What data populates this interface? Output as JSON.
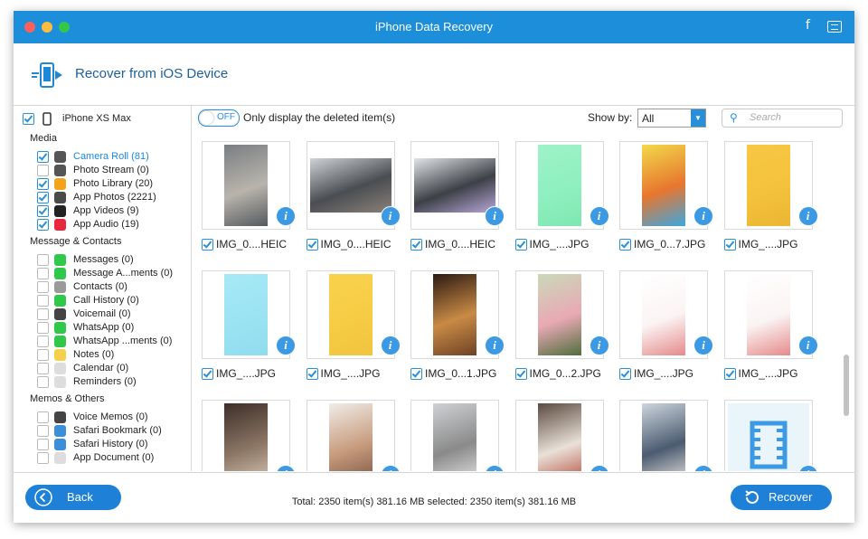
{
  "window": {
    "title": "iPhone Data Recovery"
  },
  "header": {
    "title": "Recover from iOS Device",
    "icon": "phone-transfer-icon"
  },
  "sidebar": {
    "device": {
      "label": "iPhone XS Max",
      "checked": true
    },
    "sections": [
      {
        "title": "Media",
        "items": [
          {
            "label": "Camera Roll (81)",
            "checked": true,
            "active": true,
            "icon": "camera-icon",
            "color": "#555555"
          },
          {
            "label": "Photo Stream (0)",
            "checked": false,
            "active": false,
            "icon": "photo-stream-icon",
            "color": "#555555"
          },
          {
            "label": "Photo Library (20)",
            "checked": true,
            "active": false,
            "icon": "photos-icon",
            "color": "#f3a21b"
          },
          {
            "label": "App Photos (2221)",
            "checked": true,
            "active": false,
            "icon": "app-photos-icon",
            "color": "#4a4a4a"
          },
          {
            "label": "App Videos (9)",
            "checked": true,
            "active": false,
            "icon": "app-videos-icon",
            "color": "#222222"
          },
          {
            "label": "App Audio (19)",
            "checked": true,
            "active": false,
            "icon": "music-icon",
            "color": "#e8283d"
          }
        ]
      },
      {
        "title": "Message & Contacts",
        "items": [
          {
            "label": "Messages (0)",
            "checked": false,
            "icon": "messages-icon",
            "color": "#2fc84a"
          },
          {
            "label": "Message A...ments (0)",
            "checked": false,
            "icon": "attachment-icon",
            "color": "#2fc84a"
          },
          {
            "label": "Contacts (0)",
            "checked": false,
            "icon": "contacts-icon",
            "color": "#9a9a9a"
          },
          {
            "label": "Call History (0)",
            "checked": false,
            "icon": "phone-icon",
            "color": "#2fc84a"
          },
          {
            "label": "Voicemail (0)",
            "checked": false,
            "icon": "voicemail-icon",
            "color": "#444444"
          },
          {
            "label": "WhatsApp (0)",
            "checked": false,
            "icon": "whatsapp-icon",
            "color": "#2fc84a"
          },
          {
            "label": "WhatsApp ...ments (0)",
            "checked": false,
            "icon": "whatsapp-attachment-icon",
            "color": "#2fc84a"
          },
          {
            "label": "Notes (0)",
            "checked": false,
            "icon": "notes-icon",
            "color": "#f5d04a"
          },
          {
            "label": "Calendar (0)",
            "checked": false,
            "icon": "calendar-icon",
            "color": "#dddddd"
          },
          {
            "label": "Reminders (0)",
            "checked": false,
            "icon": "reminders-icon",
            "color": "#dddddd"
          }
        ]
      },
      {
        "title": "Memos & Others",
        "items": [
          {
            "label": "Voice Memos (0)",
            "checked": false,
            "icon": "voice-memos-icon",
            "color": "#444444"
          },
          {
            "label": "Safari Bookmark (0)",
            "checked": false,
            "icon": "bookmark-icon",
            "color": "#3b8fd9"
          },
          {
            "label": "Safari History (0)",
            "checked": false,
            "icon": "safari-icon",
            "color": "#3b8fd9"
          },
          {
            "label": "App Document (0)",
            "checked": false,
            "icon": "document-icon",
            "color": "#dddddd"
          }
        ]
      }
    ]
  },
  "toolbar": {
    "toggle": "OFF",
    "only_deleted_label": "Only display the deleted item(s)",
    "show_by_label": "Show by:",
    "show_by_value": "All",
    "search_placeholder": "Search"
  },
  "grid": {
    "rows": [
      [
        {
          "name": "IMG_0....HEIC",
          "checked": true,
          "colors": [
            "#7a7e82",
            "#b8b4ac",
            "#55595e"
          ]
        },
        {
          "name": "IMG_0....HEIC",
          "checked": true,
          "colors": [
            "#cfd3d6",
            "#4a4d52",
            "#8a8178"
          ]
        },
        {
          "name": "IMG_0....HEIC",
          "checked": true,
          "colors": [
            "#e1e4e7",
            "#3d4046",
            "#b7a7d9"
          ]
        },
        {
          "name": "IMG_....JPG",
          "checked": true,
          "colors": [
            "#9ef2c6",
            "#8ff0bf",
            "#7ee7b2"
          ]
        },
        {
          "name": "IMG_0...7.JPG",
          "checked": true,
          "colors": [
            "#f2d94a",
            "#e7762f",
            "#3da7e0"
          ]
        },
        {
          "name": "IMG_....JPG",
          "checked": true,
          "colors": [
            "#f7c844",
            "#f5c23c",
            "#eab633"
          ]
        }
      ],
      [
        {
          "name": "IMG_....JPG",
          "checked": true,
          "colors": [
            "#a6e9f6",
            "#9be3f3",
            "#8fdcee"
          ]
        },
        {
          "name": "IMG_....JPG",
          "checked": true,
          "colors": [
            "#f9d24c",
            "#f6cc44",
            "#f1c53d"
          ]
        },
        {
          "name": "IMG_0...1.JPG",
          "checked": true,
          "colors": [
            "#2b1a12",
            "#c98a45",
            "#6e4325"
          ]
        },
        {
          "name": "IMG_0...2.JPG",
          "checked": true,
          "colors": [
            "#c9d9b9",
            "#e9a9b4",
            "#4f6e3d"
          ]
        },
        {
          "name": "IMG_....JPG",
          "checked": true,
          "colors": [
            "#ffffff",
            "#fbf4f4",
            "#e58a8a"
          ]
        },
        {
          "name": "IMG_....JPG",
          "checked": true,
          "colors": [
            "#ffffff",
            "#fbf4f4",
            "#e58a8a"
          ]
        }
      ],
      [
        {
          "name": "",
          "checked": false,
          "colors": [
            "#3c2e28",
            "#8b7565",
            "#d9c8b6"
          ]
        },
        {
          "name": "",
          "checked": false,
          "colors": [
            "#f1ece8",
            "#c79c7d",
            "#7a5445"
          ]
        },
        {
          "name": "",
          "checked": false,
          "colors": [
            "#cfd1d4",
            "#8a8a8a",
            "#e6e6e6"
          ]
        },
        {
          "name": "",
          "checked": false,
          "colors": [
            "#5b4a3f",
            "#e9e1d8",
            "#b44a3b"
          ]
        },
        {
          "name": "",
          "checked": false,
          "colors": [
            "#cdd6de",
            "#4b5b70",
            "#eee8e2"
          ]
        },
        {
          "name": "",
          "checked": false,
          "video": true,
          "colors": [
            "#e9f4fb",
            "#3b9ae3",
            "#ffffff"
          ]
        }
      ]
    ]
  },
  "footer": {
    "back_label": "Back",
    "status": "Total: 2350 item(s) 381.16 MB   selected: 2350 item(s) 381.16 MB",
    "recover_label": "Recover"
  },
  "colors": {
    "accent": "#1e80d6",
    "titlebar": "#1d8ed9",
    "header_text": "#1e5f9a"
  }
}
